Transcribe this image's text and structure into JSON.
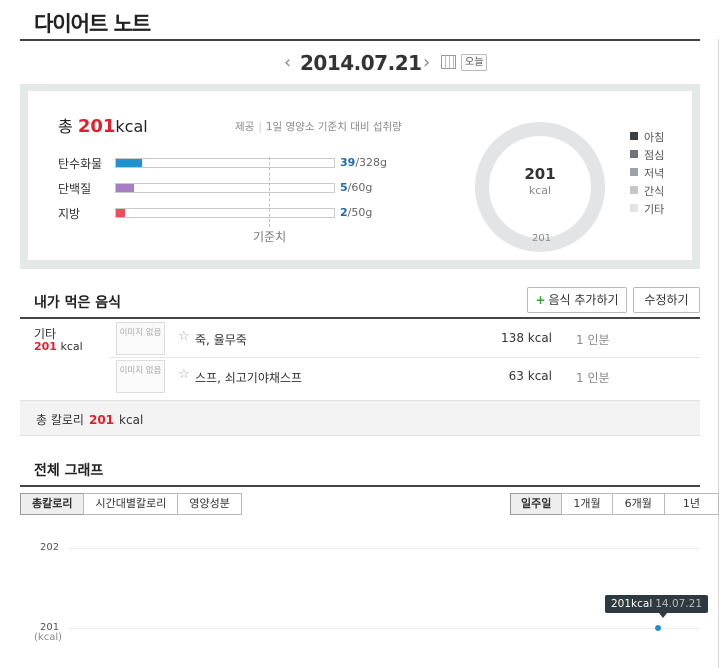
{
  "page": {
    "title": "다이어트 노트"
  },
  "datebar": {
    "prev_arrow": "‹",
    "next_arrow": "›",
    "date": "2014.07.21",
    "today_label": "오늘"
  },
  "summary": {
    "total_prefix": "총",
    "total_value": "201",
    "total_unit": "kcal",
    "provide_label": "제공",
    "provide_desc": "1일 영양소 기준치 대비 섭취량",
    "nutrients": [
      {
        "label": "탄수화물",
        "amount": "39",
        "limit": "/328g",
        "fraction": 0.119,
        "color": "#1d93d2"
      },
      {
        "label": "단백질",
        "amount": "5",
        "limit": "/60g",
        "fraction": 0.083,
        "color": "#a67ec2"
      },
      {
        "label": "지방",
        "amount": "2",
        "limit": "/50g",
        "fraction": 0.04,
        "color": "#e8505b"
      }
    ],
    "standard_label": "기준치",
    "donut_value": "201",
    "donut_unit": "kcal",
    "donut_below": "201",
    "legend": [
      {
        "label": "아침",
        "color": "#3b4046"
      },
      {
        "label": "점심",
        "color": "#6f7379"
      },
      {
        "label": "저녁",
        "color": "#9ea1a5"
      },
      {
        "label": "간식",
        "color": "#c4c6c8"
      },
      {
        "label": "기타",
        "color": "#e3e4e5"
      }
    ]
  },
  "eaten": {
    "title": "내가 먹은 음식",
    "add_button": "음식 추가하기",
    "add_plus": "+",
    "edit_button": "수정하기",
    "category": "기타",
    "category_kcal": "201",
    "category_unit": "kcal",
    "foods": [
      {
        "noimg": "이미지 없음",
        "name": "죽, 율무죽",
        "kcal": "138 kcal",
        "portion": "1 인분"
      },
      {
        "noimg": "이미지 없음",
        "name": "스프, 쇠고기야채스프",
        "kcal": "63 kcal",
        "portion": "1 인분"
      }
    ],
    "total_label": "총 칼로리",
    "total_value": "201",
    "total_unit": "kcal"
  },
  "graph": {
    "title": "전체 그래프",
    "left_tabs": [
      "총칼로리",
      "시간대별칼로리",
      "영양성분"
    ],
    "right_tabs": [
      "일주일",
      "1개월",
      "6개월",
      "1년"
    ],
    "active_left": 0,
    "active_right": 0,
    "y_unit": "(kcal)",
    "tooltip_value": "201kcal",
    "tooltip_date": "14.07.21"
  },
  "chart_data": {
    "type": "line",
    "x": [
      "14.07.21"
    ],
    "series": [
      {
        "values": [
          201
        ]
      }
    ],
    "yticks": [
      202,
      201
    ],
    "ylabel": "(kcal)",
    "ylim": [
      201,
      202
    ]
  }
}
